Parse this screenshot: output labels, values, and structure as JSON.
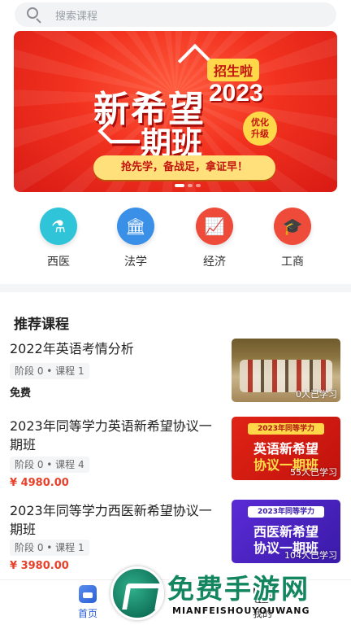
{
  "search": {
    "placeholder": "搜索课程",
    "icon": "search-icon"
  },
  "banner": {
    "title_line1": "新希望",
    "tag": "招生啦",
    "year": "2023",
    "title_line2": "一期班",
    "badge": "优化升级",
    "slogan": "抢先学，备战足，拿证早！",
    "slide_count": 3,
    "active_slide": 0
  },
  "categories": [
    {
      "label": "西医",
      "icon": "flask-icon",
      "color": "#2fc4d8"
    },
    {
      "label": "法学",
      "icon": "courthouse-icon",
      "color": "#3a8fe6"
    },
    {
      "label": "经济",
      "icon": "chart-icon",
      "color": "#ee4b3a"
    },
    {
      "label": "工商",
      "icon": "graduation-cap-icon",
      "color": "#ee4b3a"
    }
  ],
  "section_title": "推荐课程",
  "courses": [
    {
      "name": "2022年英语考情分析",
      "meta": "阶段 0 • 课程 1",
      "price": "免费",
      "learners": "0人已学习"
    },
    {
      "name": "2023年同等学力英语新希望协议一期班",
      "meta": "阶段 0 • 课程 4",
      "price": "¥ 4980.00",
      "learners": "55人已学习",
      "thumb_top": "2023年同等学力",
      "thumb_l1": "英语新希望",
      "thumb_l2": "协议一期班"
    },
    {
      "name": "2023年同等学力西医新希望协议一期班",
      "meta": "阶段 0 • 课程 1",
      "price": "¥ 3980.00",
      "learners": "104人已学习",
      "thumb_top": "2023年同等学力",
      "thumb_l1": "西医新希望",
      "thumb_l2": "协议一期班"
    }
  ],
  "colors": {
    "price": "#e8402a",
    "accent": "#2a5fd8"
  },
  "nav": [
    {
      "label": "首页",
      "icon": "home-icon",
      "active": true
    },
    {
      "label": "我的",
      "icon": "profile-icon",
      "active": false
    }
  ],
  "watermark": {
    "text": "免费手游网",
    "sub": "MIANFEISHOUYOUWANG"
  }
}
